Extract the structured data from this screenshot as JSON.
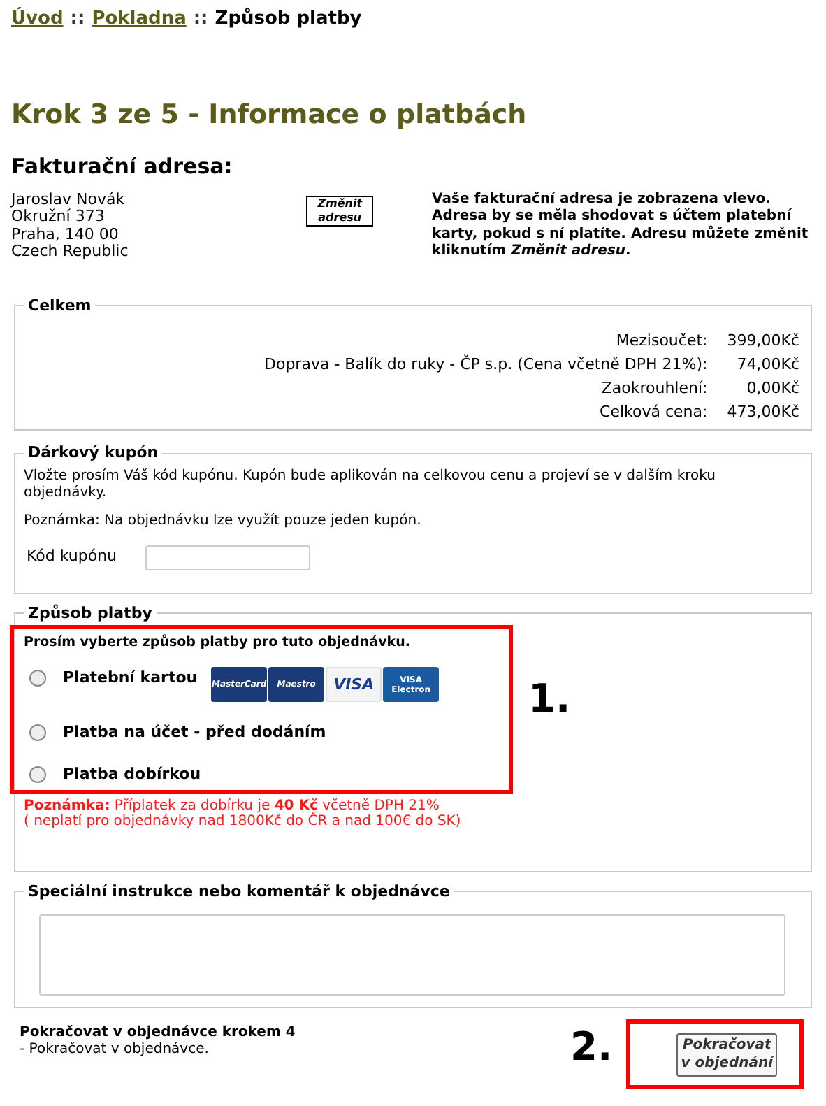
{
  "breadcrumb": [
    {
      "label": "Úvod",
      "kind": "link"
    },
    {
      "label": "::",
      "kind": "separator"
    },
    {
      "label": "Pokladna",
      "kind": "link"
    },
    {
      "label": "::",
      "kind": "separator"
    },
    {
      "label": "Způsob platby",
      "kind": "current"
    }
  ],
  "heading": "Krok 3 ze 5 - Informace o platbách",
  "billing": {
    "title": "Fakturační adresa:",
    "address": [
      "Jaroslav Novák",
      "Okružní 373",
      "Praha, 140 00",
      "Czech Republic"
    ],
    "change_button": "Změnit adresu",
    "info": "Vaše fakturační adresa je zobrazena vlevo. Adresa by se měla shodovat s účtem platební karty, pokud s ní platíte. Adresu můžete změnit kliknutím *Změnit adresu*."
  },
  "totals": {
    "title": "Celkem",
    "rows": [
      {
        "label": "Mezisoučet:",
        "value": "399,00Kč"
      },
      {
        "label": "Doprava - Balík do ruky - ČP s.p. (Cena včetně DPH 21%):",
        "value": "74,00Kč"
      },
      {
        "label": "Zaokrouhlení:",
        "value": "0,00Kč"
      },
      {
        "label": "Celková cena:",
        "value": "473,00Kč"
      }
    ]
  },
  "coupon": {
    "title": "Dárkový kupón",
    "text": "Vložte prosím Váš kód kupónu. Kupón bude aplikován na celkovou cenu a projeví se v dalším kroku objednávky.",
    "note": "Poznámka: Na objednávku lze využít pouze jeden kupón.",
    "field_label": "Kód kupónu"
  },
  "payment": {
    "title": "Způsob platby",
    "prompt": "Prosím vyberte způsob platby pro tuto objednávku.",
    "options": [
      {
        "label": "Platební kartou",
        "selected": false,
        "card_logos": [
          {
            "kind": "mastercard",
            "label": "MasterCard"
          },
          {
            "kind": "maestro",
            "label": "Maestro"
          },
          {
            "kind": "visa",
            "label": "VISA"
          },
          {
            "kind": "electron",
            "label": "VISA Electron"
          }
        ]
      },
      {
        "label": "Platba na účet - před dodáním",
        "selected": false
      },
      {
        "label": "Platba dobírkou",
        "selected": false
      }
    ],
    "note": "**Poznámka:** Příplatek za dobírku je **40 Kč** včetně DPH 21%",
    "note_2": "( neplatí pro objednávky nad 1800Kč do ČR a nad 100€ do SK)"
  },
  "comments": {
    "title": "Speciální instrukce nebo komentář k objednávce"
  },
  "footer": {
    "title": "Pokračovat v objednávce krokem 4",
    "text": "- Pokračovat v objednávce.",
    "continue_button": "Pokračovat v objednání"
  },
  "annotations": [
    "1.",
    "2."
  ]
}
